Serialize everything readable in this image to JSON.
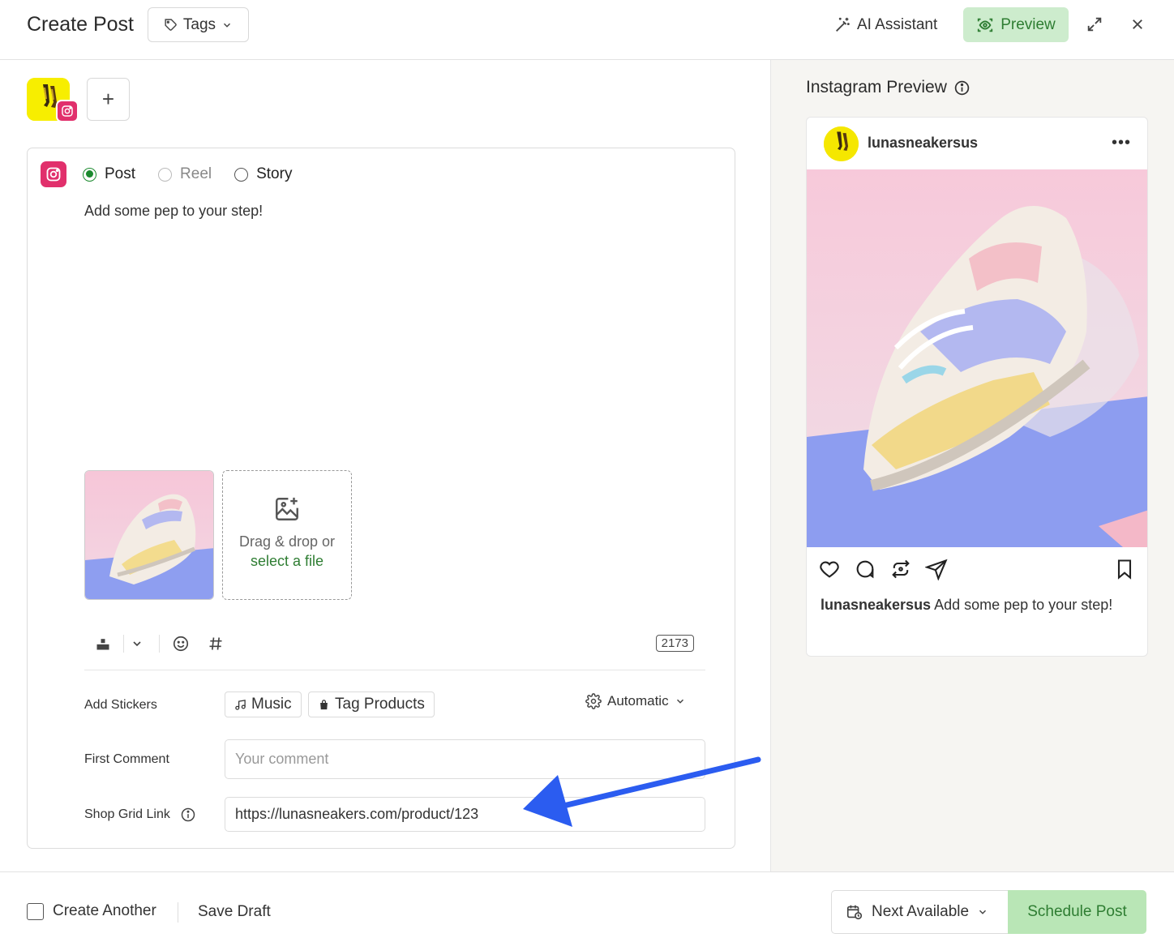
{
  "header": {
    "title": "Create Post",
    "tags_label": "Tags",
    "ai_label": "AI Assistant",
    "preview_label": "Preview"
  },
  "accounts": {
    "add_label": "+"
  },
  "composer": {
    "post_types": [
      {
        "label": "Post",
        "state": "checked"
      },
      {
        "label": "Reel",
        "state": "disabled"
      },
      {
        "label": "Story",
        "state": "unchecked"
      }
    ],
    "text": "Add some pep to your step!",
    "dropzone_text": "Drag & drop or",
    "dropzone_link": "select a file",
    "char_count": "2173"
  },
  "fields": {
    "stickers_label": "Add Stickers",
    "music_label": "Music",
    "tag_products_label": "Tag Products",
    "automatic_label": "Automatic",
    "first_comment_label": "First Comment",
    "first_comment_placeholder": "Your comment",
    "shop_grid_label": "Shop Grid Link",
    "shop_grid_value": "https://lunasneakers.com/product/123"
  },
  "preview": {
    "title": "Instagram Preview",
    "username": "lunasneakersus",
    "more": "•••",
    "caption_user": "lunasneakersus",
    "caption_text": " Add some pep to your step!"
  },
  "footer": {
    "create_another_label": "Create Another",
    "save_draft_label": "Save Draft",
    "next_available_label": "Next Available",
    "schedule_label": "Schedule Post"
  },
  "colors": {
    "accent_green": "#2e7d32",
    "preview_bg": "#cdeccd",
    "schedule_bg": "#b9e6b6",
    "instagram": "#e1306c",
    "annotation_arrow": "#2b5cf0"
  }
}
